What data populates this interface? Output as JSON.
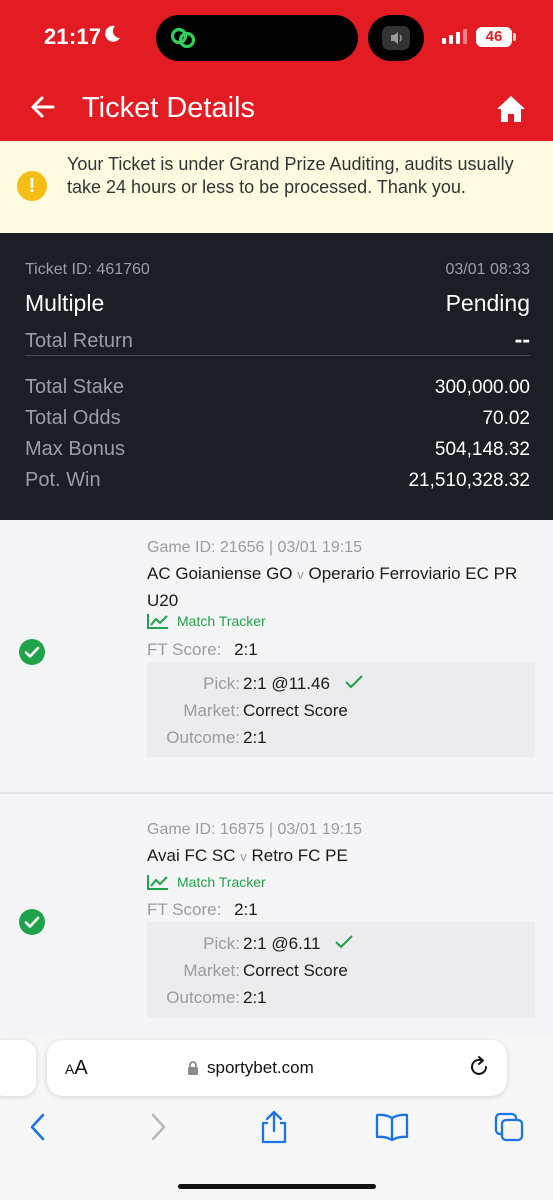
{
  "status_bar": {
    "time": "21:17",
    "battery": "46"
  },
  "header": {
    "title": "Ticket Details"
  },
  "notice": {
    "text": "Your Ticket is under Grand Prize Auditing, audits usually take 24 hours or less to be processed. Thank you."
  },
  "summary": {
    "ticket_id": "Ticket ID: 461760",
    "datetime": "03/01 08:33",
    "bet_type": "Multiple",
    "status": "Pending",
    "total_return_label": "Total Return",
    "total_return_value": "--",
    "rows": [
      {
        "label": "Total Stake",
        "value": "300,000.00"
      },
      {
        "label": "Total Odds",
        "value": "70.02"
      },
      {
        "label": "Max Bonus",
        "value": "504,148.32"
      },
      {
        "label": "Pot. Win",
        "value": "21,510,328.32"
      }
    ]
  },
  "selections": [
    {
      "game_id": "Game ID: 21656 | 03/01 19:15",
      "home": "AC Goianiense GO",
      "vs": "v",
      "away": "Operario Ferroviario EC PR U20",
      "tracker": "Match Tracker",
      "ft_label": "FT Score:",
      "ft_value": "2:1",
      "pick_label": "Pick:",
      "pick_value": "2:1 @11.46",
      "market_label": "Market:",
      "market_value": "Correct Score",
      "outcome_label": "Outcome:",
      "outcome_value": "2:1"
    },
    {
      "game_id": "Game ID: 16875 | 03/01 19:15",
      "home": "Avai FC SC",
      "vs": "v",
      "away": "Retro FC PE",
      "tracker": "Match Tracker",
      "ft_label": "FT Score:",
      "ft_value": "2:1",
      "pick_label": "Pick:",
      "pick_value": "2:1 @6.11",
      "market_label": "Market:",
      "market_value": "Correct Score",
      "outcome_label": "Outcome:",
      "outcome_value": "2:1"
    }
  ],
  "browser": {
    "aa_small": "A",
    "aa_big": "A",
    "url": "sportybet.com"
  },
  "colors": {
    "brand_red": "#e31b23",
    "dark_panel": "#1b1e25",
    "success_green": "#1fa34a",
    "notice_bg": "#fffbe0",
    "notice_icon": "#f5be14",
    "ios_blue": "#1a73e8"
  }
}
